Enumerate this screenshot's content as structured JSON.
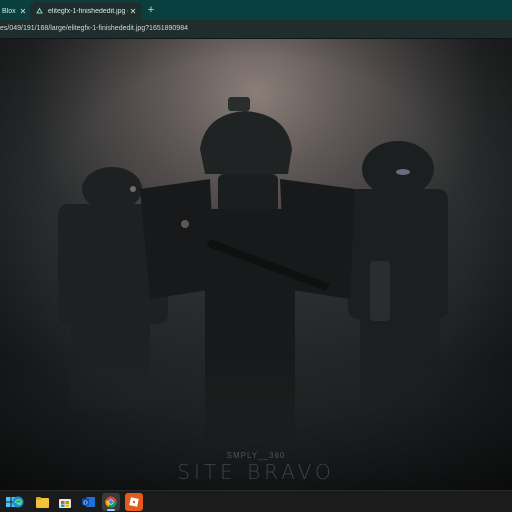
{
  "browser": {
    "tabs": [
      {
        "label": "Blox",
        "active": false
      },
      {
        "label": "elitegfx-1-finishededit.jpg (19...",
        "active": true
      }
    ],
    "close_glyph": "✕",
    "new_tab_glyph": "+",
    "url": "es/049/191/168/large/elitegfx-1-finishededit.jpg?1651890984"
  },
  "image": {
    "caption_small": "SMPLY__360",
    "caption_large": "SITE BRAVO"
  },
  "taskbar": {
    "apps": [
      {
        "name": "windows-start-icon"
      },
      {
        "name": "edge-icon"
      },
      {
        "name": "file-explorer-icon"
      },
      {
        "name": "microsoft-store-icon"
      },
      {
        "name": "outlook-icon"
      },
      {
        "name": "chrome-icon"
      },
      {
        "name": "roblox-icon"
      }
    ]
  },
  "colors": {
    "tabstrip": "#0a3f3f",
    "active_tab": "#1f2d2d",
    "taskbar": "#1b1b1b"
  }
}
